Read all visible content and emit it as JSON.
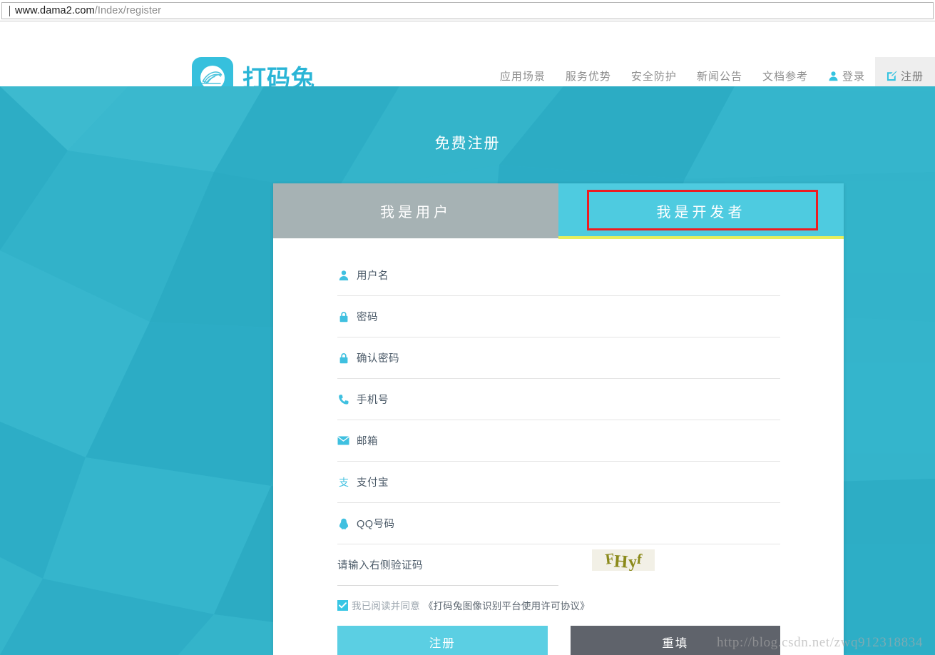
{
  "browser": {
    "url_host": "www.dama2.com",
    "url_path": "/Index/register"
  },
  "header": {
    "logo_text": "打码兔",
    "logo_icon": "rabbit-logo-icon",
    "nav_items": [
      {
        "label": "应用场景",
        "icon": null
      },
      {
        "label": "服务优势",
        "icon": null
      },
      {
        "label": "安全防护",
        "icon": null
      },
      {
        "label": "新闻公告",
        "icon": null
      },
      {
        "label": "文档参考",
        "icon": null
      },
      {
        "label": "登录",
        "icon": "user-icon"
      },
      {
        "label": "注册",
        "icon": "edit-icon"
      }
    ]
  },
  "page": {
    "title": "免费注册"
  },
  "tabs": [
    {
      "label": "我是用户",
      "active": false
    },
    {
      "label": "我是开发者",
      "active": true
    }
  ],
  "form": {
    "fields": [
      {
        "icon": "user-icon",
        "placeholder": "用户名",
        "value": ""
      },
      {
        "icon": "lock-icon",
        "placeholder": "密码",
        "value": ""
      },
      {
        "icon": "lock-icon",
        "placeholder": "确认密码",
        "value": ""
      },
      {
        "icon": "phone-icon",
        "placeholder": "手机号",
        "value": ""
      },
      {
        "icon": "envelope-icon",
        "placeholder": "邮箱",
        "value": ""
      },
      {
        "icon": "alipay-icon",
        "placeholder": "支付宝",
        "value": ""
      },
      {
        "icon": "qq-icon",
        "placeholder": "QQ号码",
        "value": ""
      }
    ],
    "captcha": {
      "placeholder": "请输入右侧验证码",
      "value": "",
      "image_text": "FHyf",
      "chars": [
        "F",
        "H",
        "y",
        "f"
      ]
    },
    "agreement": {
      "checked": true,
      "text": "我已阅读并同意",
      "link": "《打码兔图像识别平台使用许可协议》"
    },
    "submit_label": "注册",
    "reset_label": "重填"
  },
  "watermark": "http://blog.csdn.net/zwq912318834",
  "colors": {
    "brand_cyan": "#2ab5d6",
    "bg_teal": "#2fb2ca",
    "tab_active": "#4ecbe0",
    "tab_inactive": "#a6b2b4",
    "tab_underline": "#e7ef5d",
    "highlight_red": "#ee1c21",
    "submit": "#5bcfe3",
    "reset": "#5f636b",
    "captcha_text": "#8b8a1b"
  }
}
